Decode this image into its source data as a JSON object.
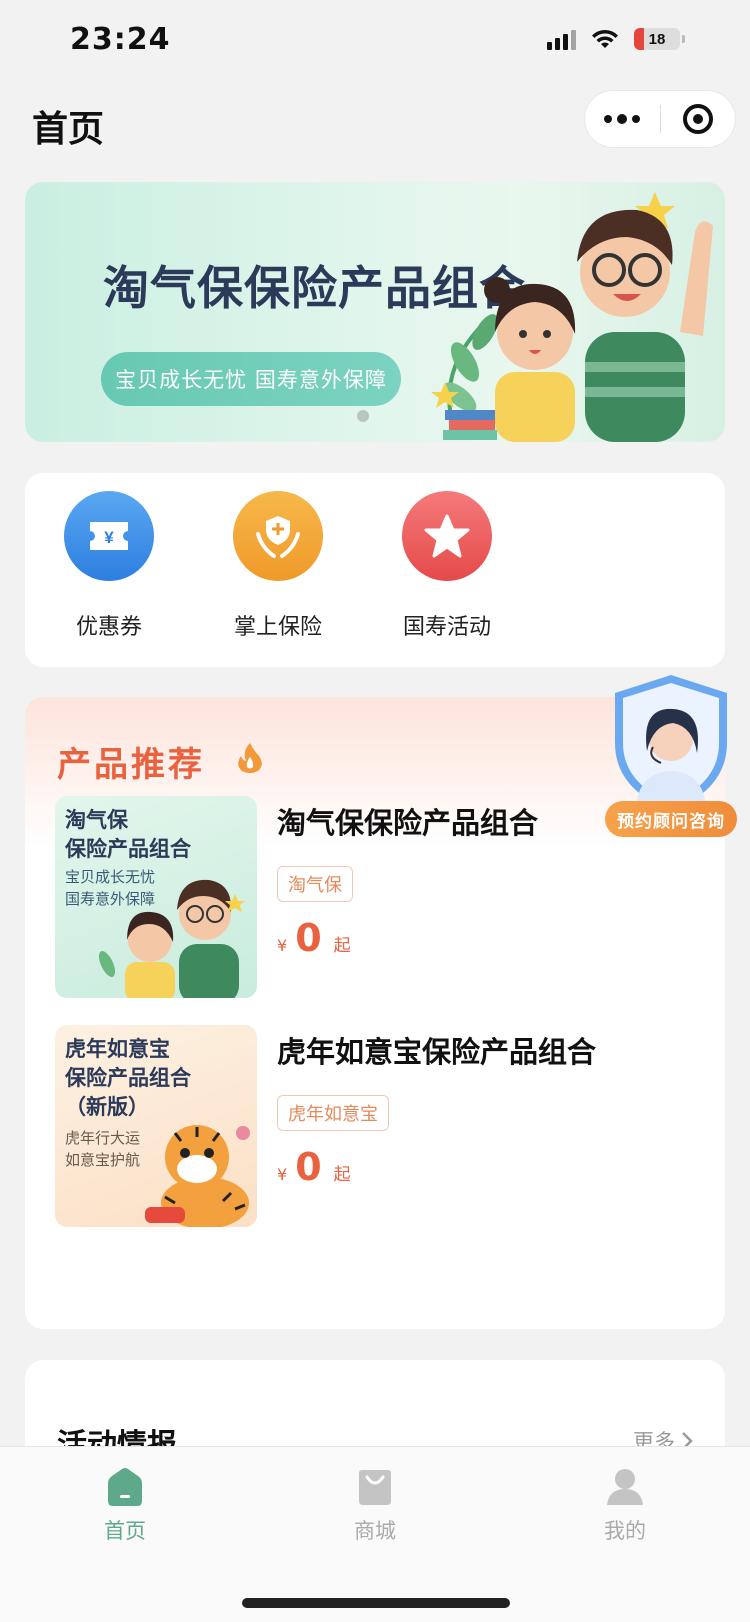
{
  "status_bar": {
    "time": "23:24",
    "battery": "18"
  },
  "header": {
    "title": "首页"
  },
  "banner": {
    "title": "淘气保保险产品组合",
    "subtitle": "宝贝成长无忧  国寿意外保障"
  },
  "quick_menu": [
    {
      "label": "优惠券",
      "icon": "coupon-icon",
      "color": "#3d8de8"
    },
    {
      "label": "掌上保险",
      "icon": "hands-shield-icon",
      "color": "#f2a33a"
    },
    {
      "label": "国寿活动",
      "icon": "star-icon",
      "color": "#ee5a5a"
    }
  ],
  "products_section": {
    "heading": "产品推荐",
    "items": [
      {
        "thumb_title_1": "淘气保",
        "thumb_title_2": "保险产品组合",
        "thumb_sub_1": "宝贝成长无忧",
        "thumb_sub_2": "国寿意外保障",
        "name": "淘气保保险产品组合",
        "tag": "淘气保",
        "currency": "¥",
        "price": "0",
        "price_suffix": "起"
      },
      {
        "thumb_title_1": "虎年如意宝",
        "thumb_title_2": "保险产品组合",
        "thumb_title_3": "（新版）",
        "thumb_sub_1": "虎年行大运",
        "thumb_sub_2": "如意宝护航",
        "name": "虎年如意宝保险产品组合",
        "tag": "虎年如意宝",
        "currency": "¥",
        "price": "0",
        "price_suffix": "起"
      }
    ]
  },
  "advisor": {
    "label": "预约顾问咨询"
  },
  "activities": {
    "title": "活动情报",
    "more": "更多"
  },
  "tabbar": [
    {
      "label": "首页",
      "icon": "home-icon",
      "active": true
    },
    {
      "label": "商城",
      "icon": "shopping-bag-icon",
      "active": false
    },
    {
      "label": "我的",
      "icon": "user-icon",
      "active": false
    }
  ],
  "colors": {
    "accent": "#5ea98a",
    "price": "#e9623f",
    "section_heading": "#e9623f"
  }
}
